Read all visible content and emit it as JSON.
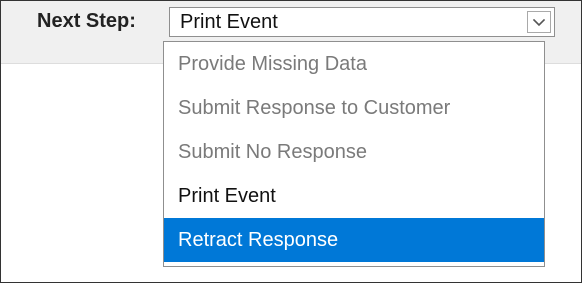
{
  "field": {
    "label": "Next Step:",
    "selected_value": "Print Event",
    "arrow_icon": "chevron-down-icon"
  },
  "dropdown": {
    "options": [
      {
        "label": "Provide Missing Data",
        "state": "disabled"
      },
      {
        "label": "Submit Response to Customer",
        "state": "disabled"
      },
      {
        "label": "Submit No Response",
        "state": "disabled"
      },
      {
        "label": "Print Event",
        "state": "enabled"
      },
      {
        "label": "Retract Response",
        "state": "highlighted"
      }
    ],
    "highlight_color": "#0078d7",
    "disabled_text_color": "#7a7a7a"
  }
}
